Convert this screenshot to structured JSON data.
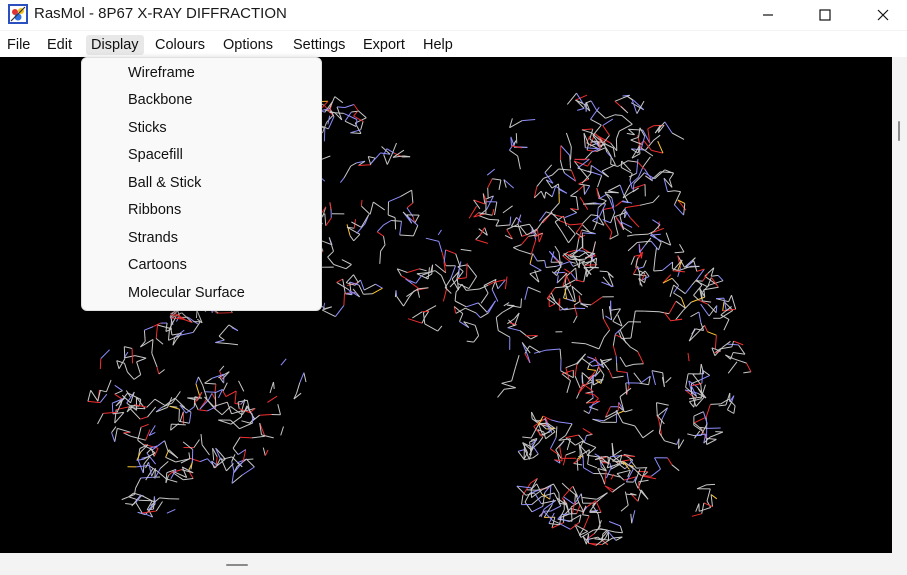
{
  "window": {
    "title": "RasMol - 8P67 X-RAY DIFFRACTION",
    "app_icon": "rasmol-app-icon",
    "controls": [
      "minimize-icon",
      "maximize-icon",
      "close-icon"
    ]
  },
  "menubar": {
    "items": [
      "File",
      "Edit",
      "Display",
      "Colours",
      "Options",
      "Settings",
      "Export",
      "Help"
    ],
    "active": "Display"
  },
  "display_menu": {
    "items": [
      "Wireframe",
      "Backbone",
      "Sticks",
      "Spacefill",
      "Ball & Stick",
      "Ribbons",
      "Strands",
      "Cartoons",
      "Molecular Surface"
    ]
  },
  "viewer": {
    "background": "#000000",
    "bond_colors": [
      "#c8c8c8",
      "#8f8fff",
      "#f03030",
      "#ffc832"
    ]
  }
}
